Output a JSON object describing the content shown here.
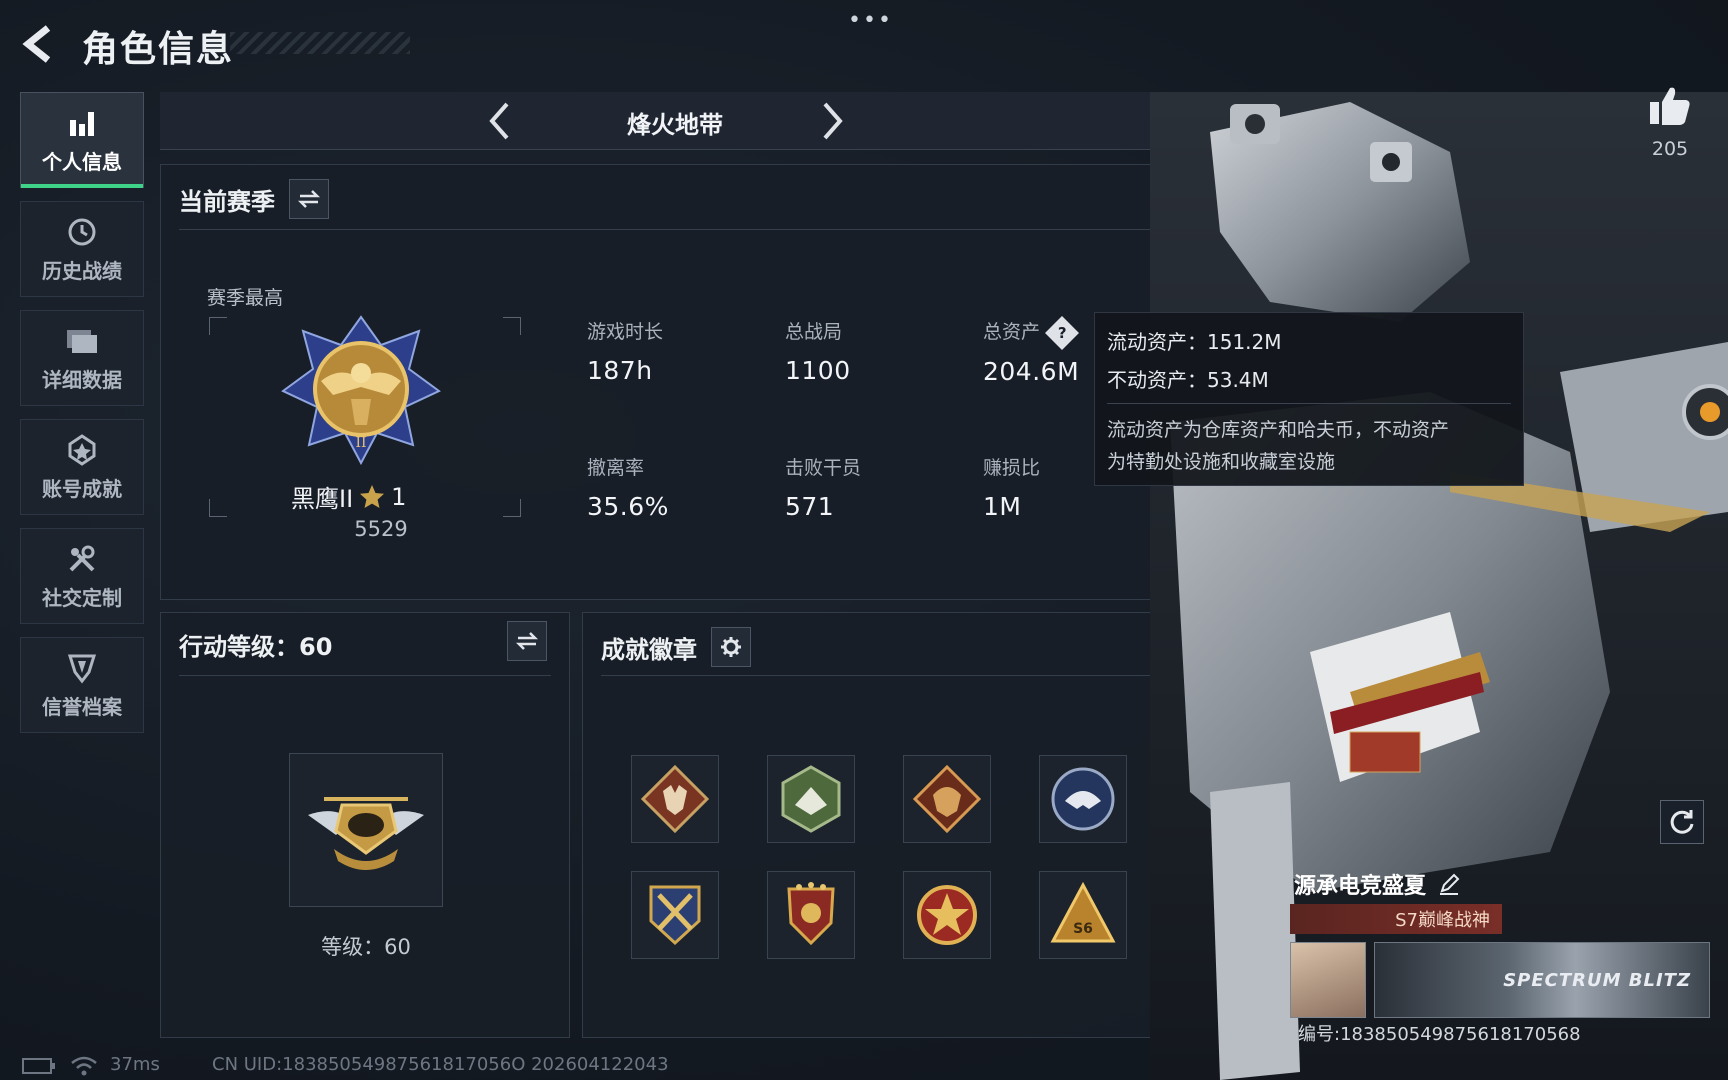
{
  "header": {
    "title": "角色信息"
  },
  "nav": [
    {
      "label": "个人信息",
      "icon": "bar-chart-icon",
      "active": true
    },
    {
      "label": "历史战绩",
      "icon": "history-icon"
    },
    {
      "label": "详细数据",
      "icon": "folder-icon"
    },
    {
      "label": "账号成就",
      "icon": "achievement-icon"
    },
    {
      "label": "社交定制",
      "icon": "tools-icon"
    },
    {
      "label": "信誉档案",
      "icon": "shield-icon"
    }
  ],
  "mode": {
    "title": "烽火地带"
  },
  "season": {
    "title": "当前赛季",
    "subtitle": "赛季最高",
    "rank_name": "黑鹰II",
    "rank_stars": "1",
    "rank_score": "5529",
    "stats": [
      {
        "label": "游戏时长",
        "value": "187h"
      },
      {
        "label": "总战局",
        "value": "1100"
      },
      {
        "label": "总资产",
        "value": "204.6M"
      },
      {
        "label": "撤离率",
        "value": "35.6%"
      },
      {
        "label": "击败干员",
        "value": "571"
      },
      {
        "label": "赚损比",
        "value": "1M"
      }
    ],
    "asset_help": "?"
  },
  "tooltip": {
    "liquid": "流动资产：151.2M",
    "fixed": "不动资产：53.4M",
    "desc_1": "流动资产为仓库资产和哈夫币，不动资产",
    "desc_2": "为特勤处设施和收藏室设施"
  },
  "level": {
    "title": "行动等级：60",
    "text": "等级：60"
  },
  "achievements": {
    "title": "成就徽章",
    "badges": [
      "wolf-badge-icon",
      "wasp-badge-icon",
      "dragon-badge-icon",
      "eagle-badge-icon",
      "crossed-swords-badge-icon",
      "shield-badge-icon",
      "star-badge-icon",
      "s6-badge-icon"
    ]
  },
  "likes": {
    "count": "205"
  },
  "player": {
    "name": "源承电竞盛夏",
    "title_badge": "S7巅峰战神",
    "banner_text": "SPECTRUM BLITZ",
    "id_line": "编号:18385054987561817056",
    "id_suffix": "8"
  },
  "footer": {
    "ping": "37ms",
    "uid": "CN UID:18385054987561817056O 202604122043"
  },
  "colors": {
    "accent_green": "#3fd38a",
    "gold": "#c8a14a",
    "panel": "#181e27"
  }
}
